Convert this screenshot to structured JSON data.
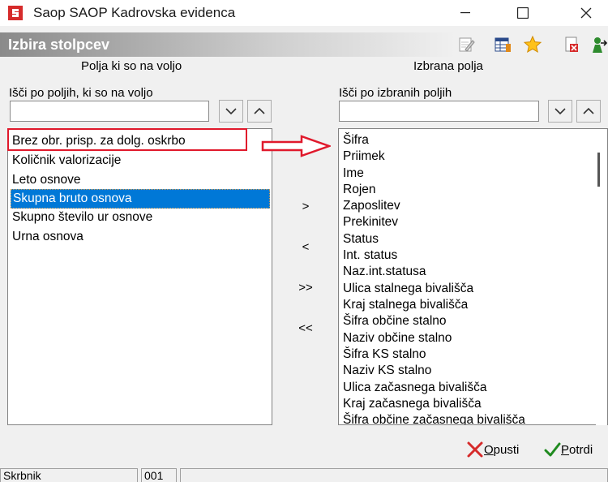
{
  "window": {
    "title": "Saop SAOP Kadrovska evidenca",
    "controls": [
      "minimize",
      "maximize",
      "close"
    ]
  },
  "header": {
    "title": "Izbira stolpcev",
    "tools": [
      "edit-icon",
      "grid-icon",
      "star-icon",
      "delete-icon",
      "exit-icon"
    ]
  },
  "left_panel": {
    "title": "Polja ki so na voljo",
    "search_label": "Išči po poljih, ki so na voljo",
    "search_value": "",
    "items": [
      "Brez obr. prisp. za dolg. oskrbo",
      "Količnik valorizacije",
      "Leto osnove",
      "Skupna bruto osnova",
      "Skupno število ur osnove",
      "Urna osnova"
    ],
    "selected_item": "Skupna bruto osnova"
  },
  "move_buttons": {
    "add": ">",
    "remove": "<",
    "add_all": ">>",
    "remove_all": "<<"
  },
  "right_panel": {
    "title": "Izbrana polja",
    "search_label": "Išči po izbranih poljih",
    "search_value": "",
    "items": [
      "Šifra",
      "Priimek",
      "Ime",
      "Rojen",
      "Zaposlitev",
      "Prekinitev",
      "Status",
      "Int. status",
      "Naz.int.statusa",
      "Ulica stalnega bivališča",
      "Kraj stalnega bivališča",
      "Šifra občine stalno",
      "Naziv občine stalno",
      "Šifra KS stalno",
      "Naziv KS stalno",
      "Ulica začasnega bivališča",
      "Kraj začasnega bivališča",
      "Šifra občine začasnega bivališča"
    ]
  },
  "actions": {
    "cancel_underlined": "O",
    "cancel_rest": "pusti",
    "confirm_underlined": "P",
    "confirm_rest": "otrdi"
  },
  "status": {
    "user": "Skrbnik",
    "code": "001",
    "extra": ""
  },
  "colors": {
    "selection": "#0078d7",
    "annotation": "#e0192c"
  }
}
